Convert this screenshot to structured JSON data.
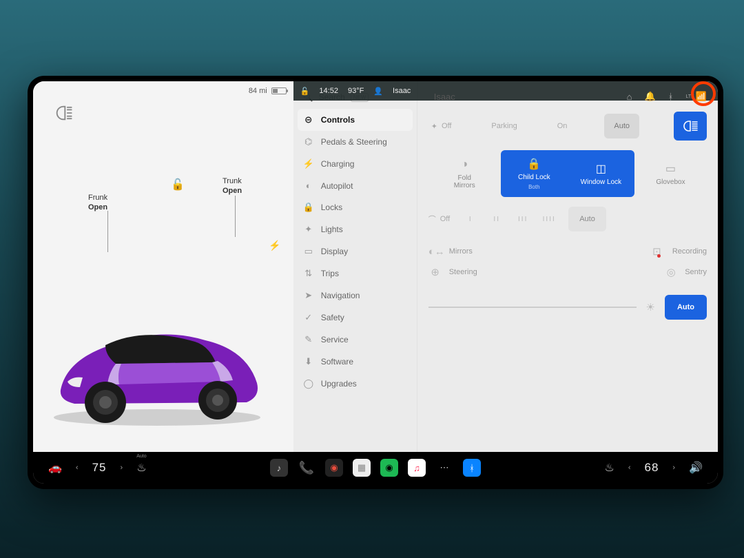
{
  "status": {
    "range": "84 mi",
    "time": "14:52",
    "temp": "93°F",
    "profile": "Isaac"
  },
  "left": {
    "frunk": {
      "label": "Frunk",
      "state": "Open"
    },
    "trunk": {
      "label": "Trunk",
      "state": "Open"
    }
  },
  "search": {
    "label": "Search",
    "badge": "NEW"
  },
  "menu": [
    {
      "icon": "⊝",
      "label": "Controls",
      "active": true
    },
    {
      "icon": "⌬",
      "label": "Pedals & Steering"
    },
    {
      "icon": "⚡",
      "label": "Charging"
    },
    {
      "icon": "◐",
      "label": "Autopilot"
    },
    {
      "icon": "🔒",
      "label": "Locks"
    },
    {
      "icon": "✦",
      "label": "Lights"
    },
    {
      "icon": "▭",
      "label": "Display"
    },
    {
      "icon": "⇅",
      "label": "Trips"
    },
    {
      "icon": "➤",
      "label": "Navigation"
    },
    {
      "icon": "✓",
      "label": "Safety"
    },
    {
      "icon": "✎",
      "label": "Service"
    },
    {
      "icon": "⬇",
      "label": "Software"
    },
    {
      "icon": "◯",
      "label": "Upgrades"
    }
  ],
  "controls": {
    "profile": "Isaac",
    "signal_label": "LTE",
    "lights": {
      "off": "Off",
      "parking": "Parking",
      "on": "On",
      "auto": "Auto"
    },
    "tiles": {
      "fold_mirrors": "Fold Mirrors",
      "child_lock": "Child Lock",
      "child_lock_sub": "Both",
      "window_lock": "Window Lock",
      "glovebox": "Glovebox"
    },
    "wipers": {
      "off": "Off",
      "l1": "I",
      "l2": "II",
      "l3": "III",
      "l4": "IIII",
      "auto": "Auto"
    },
    "mirrors": "Mirrors",
    "recording": "Recording",
    "steering": "Steering",
    "sentry": "Sentry",
    "brightness_auto": "Auto"
  },
  "dock": {
    "left_temp": "75",
    "right_temp": "68",
    "seat_label": "Auto"
  }
}
